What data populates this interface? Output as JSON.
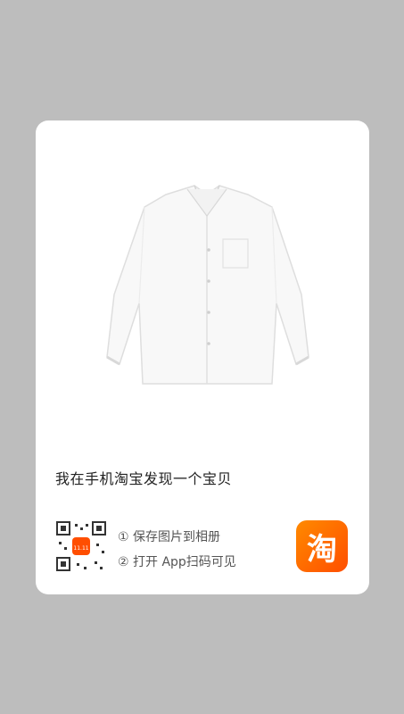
{
  "card": {
    "title": "我在手机淘宝发现一个宝贝",
    "steps": [
      "① 保存图片到相册",
      "② 打开 App扫码可见"
    ],
    "logo_glyph": "淘",
    "qr_center_badge": "11.11"
  },
  "colors": {
    "background": "#bdbdbd",
    "card": "#ffffff",
    "brand": "#ff5000"
  },
  "icons": [
    "white-shirt-image",
    "qr-code-icon",
    "taobao-logo-icon"
  ]
}
